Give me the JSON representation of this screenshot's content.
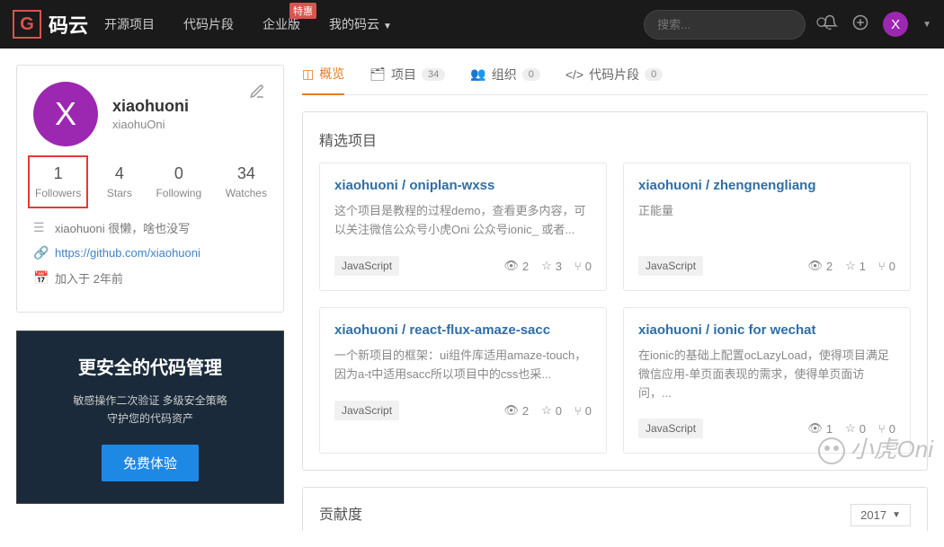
{
  "brand": {
    "name": "码云"
  },
  "nav": {
    "items": [
      "开源项目",
      "代码片段",
      "企业版",
      "我的码云"
    ],
    "enterprise_badge": "特惠"
  },
  "search": {
    "placeholder": "搜索..."
  },
  "avatar": {
    "letter": "X"
  },
  "profile": {
    "avatar_letter": "X",
    "username": "xiaohuoni",
    "handle": "xiaohuOni",
    "stats": [
      {
        "num": "1",
        "label": "Followers",
        "highlight": true
      },
      {
        "num": "4",
        "label": "Stars"
      },
      {
        "num": "0",
        "label": "Following"
      },
      {
        "num": "34",
        "label": "Watches"
      }
    ],
    "bio": "xiaohuoni 很懒，啥也没写",
    "link": "https://github.com/xiaohuoni",
    "joined": "加入于 2年前"
  },
  "promo": {
    "title": "更安全的代码管理",
    "line1": "敏感操作二次验证   多级安全策略",
    "line2": "守护您的代码资产",
    "button": "免费体验"
  },
  "tabs": {
    "overview": "概览",
    "projects": "项目",
    "projects_count": "34",
    "orgs": "组织",
    "orgs_count": "0",
    "snippets": "代码片段",
    "snippets_count": "0"
  },
  "featured": {
    "title": "精选项目",
    "repos": [
      {
        "title": "xiaohuoni / oniplan-wxss",
        "desc": "这个项目是教程的过程demo，查看更多内容，可以关注微信公众号小虎Oni 公众号ionic_ 或者...",
        "lang": "JavaScript",
        "watch": "2",
        "star": "3",
        "fork": "0"
      },
      {
        "title": "xiaohuoni / zhengnengliang",
        "desc": "正能量",
        "lang": "JavaScript",
        "watch": "2",
        "star": "1",
        "fork": "0"
      },
      {
        "title": "xiaohuoni / react-flux-amaze-sacc",
        "desc": "一个新项目的框架：ui组件库适用amaze-touch，因为a-t中适用sacc所以项目中的css也采...",
        "lang": "JavaScript",
        "watch": "2",
        "star": "0",
        "fork": "0"
      },
      {
        "title": "xiaohuoni / ionic for wechat",
        "desc": "在ionic的基础上配置ocLazyLoad，使得项目满足微信应用-单页面表现的需求，使得单页面访问，...",
        "lang": "JavaScript",
        "watch": "1",
        "star": "0",
        "fork": "0"
      }
    ]
  },
  "contrib": {
    "title": "贡献度",
    "year": "2017"
  },
  "watermark": "小虎Oni"
}
